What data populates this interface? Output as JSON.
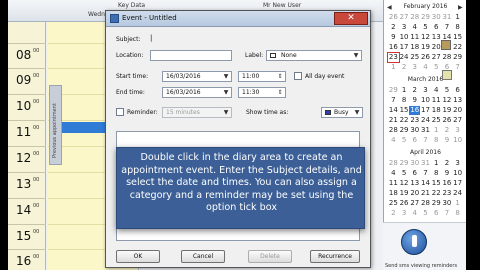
{
  "diary": {
    "header_date": "Wedn",
    "header_key": "Key Data",
    "header_user": "Mr New User",
    "hours": [
      {
        "h": "08",
        "m": "00"
      },
      {
        "h": "09",
        "m": "00"
      },
      {
        "h": "10",
        "m": "00"
      },
      {
        "h": "11",
        "m": "00"
      },
      {
        "h": "12",
        "m": "00"
      },
      {
        "h": "13",
        "m": "00"
      },
      {
        "h": "14",
        "m": "00"
      },
      {
        "h": "15",
        "m": "00"
      },
      {
        "h": "16",
        "m": "00"
      }
    ],
    "side_tab_label": "Previous appointment"
  },
  "dialog": {
    "title": "Event - Untitled",
    "close_symbol": "✕",
    "subject_label": "Subject:",
    "subject_value": "",
    "location_label": "Location:",
    "location_value": "",
    "label_label": "Label:",
    "label_value": "None",
    "start_label": "Start time:",
    "start_date": "16/03/2016",
    "start_time": "11:00",
    "all_day_label": "All day event",
    "end_label": "End time:",
    "end_date": "16/03/2016",
    "end_time": "11:30",
    "reminder_label": "Reminder:",
    "reminder_value": "15 minutes",
    "show_as_label": "Show time as:",
    "show_as_value": "Busy",
    "show_as_color": "#2f3fb0",
    "buttons": {
      "ok": "OK",
      "cancel": "Cancel",
      "delete": "Delete",
      "recurrence": "Recurrence"
    }
  },
  "calendars": [
    {
      "title": "February 2016",
      "days": [
        "26",
        "27",
        "28",
        "29",
        "30",
        "31",
        "1",
        "2",
        "3",
        "4",
        "5",
        "6",
        "7",
        "8",
        "9",
        "10",
        "11",
        "12",
        "13",
        "14",
        "15",
        "16",
        "17",
        "18",
        "19",
        "20",
        "21",
        "22",
        "23",
        "24",
        "25",
        "26",
        "27",
        "28",
        "29",
        "1",
        "2",
        "3",
        "4",
        "5",
        "6",
        "7"
      ]
    },
    {
      "title": "March 2016",
      "days": [
        "29",
        "1",
        "2",
        "3",
        "4",
        "5",
        "6",
        "7",
        "8",
        "9",
        "10",
        "11",
        "12",
        "13",
        "14",
        "15",
        "16",
        "17",
        "18",
        "19",
        "20",
        "21",
        "22",
        "23",
        "24",
        "25",
        "26",
        "27",
        "28",
        "29",
        "30",
        "31",
        "1",
        "2",
        "3",
        "4",
        "5",
        "6",
        "7",
        "8",
        "9",
        "10"
      ]
    },
    {
      "title": "April 2016",
      "days": [
        "28",
        "29",
        "30",
        "31",
        "1",
        "2",
        "3",
        "4",
        "5",
        "6",
        "7",
        "8",
        "9",
        "10",
        "11",
        "12",
        "13",
        "14",
        "15",
        "16",
        "17",
        "18",
        "19",
        "20",
        "21",
        "22",
        "23",
        "24",
        "25",
        "26",
        "27",
        "28",
        "29",
        "30",
        "1",
        "2",
        "3",
        "4",
        "5",
        "6",
        "7",
        "8"
      ]
    }
  ],
  "sms": {
    "text": "Send sms viewing reminders"
  },
  "overlay": {
    "text": "Double click in the diary area to create an appointment event.  Enter the Subject details, and select the date and times. You can also assign a category and a reminder may be set using the option tick box"
  }
}
